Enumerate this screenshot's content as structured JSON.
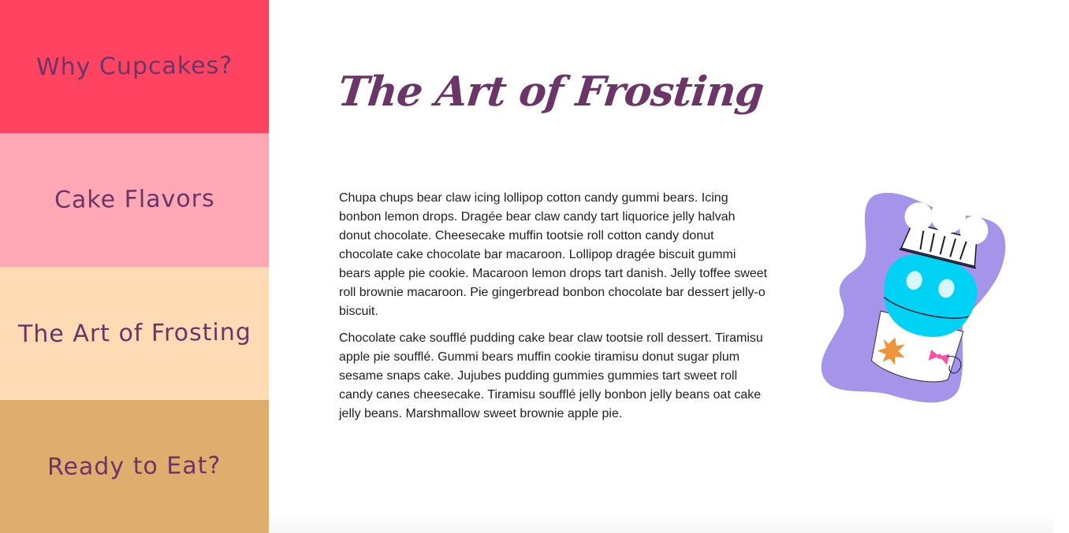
{
  "sidebar": {
    "items": [
      {
        "label": "Why Cupcakes?",
        "color": "#ff4361"
      },
      {
        "label": "Cake Flavors",
        "color": "#ffa8b5"
      },
      {
        "label": "The Art of Frosting",
        "color": "#ffdbb5"
      },
      {
        "label": "Ready to Eat?",
        "color": "#dfad6e"
      }
    ]
  },
  "main": {
    "title": "The Art of Frosting",
    "paragraphs": [
      "Chupa chups bear claw icing lollipop cotton candy gummi bears. Icing bonbon lemon drops. Dragée bear claw candy tart liquorice jelly halvah donut chocolate. Cheesecake muffin tootsie roll cotton candy donut chocolate cake chocolate bar macaroon. Lollipop dragée biscuit gummi bears apple pie cookie. Macaroon lemon drops tart danish. Jelly toffee sweet roll brownie macaroon. Pie gingerbread bonbon chocolate bar dessert jelly-o biscuit.",
      "Chocolate cake soufflé pudding cake bear claw tootsie roll dessert. Tiramisu apple pie soufflé. Gummi bears muffin cookie tiramisu donut sugar plum sesame snaps cake. Jujubes pudding gummies gummies tart sweet roll candy canes cheesecake. Tiramisu soufflé jelly bonbon jelly beans oat cake jelly beans. Marshmallow sweet brownie apple pie."
    ],
    "illustration": "frosting-piping-bag-chef-hat-icon"
  },
  "colors": {
    "text_accent": "#6b3568",
    "blob": "#a594ea",
    "bag": "#00d2f5",
    "hat": "#ffffff"
  }
}
